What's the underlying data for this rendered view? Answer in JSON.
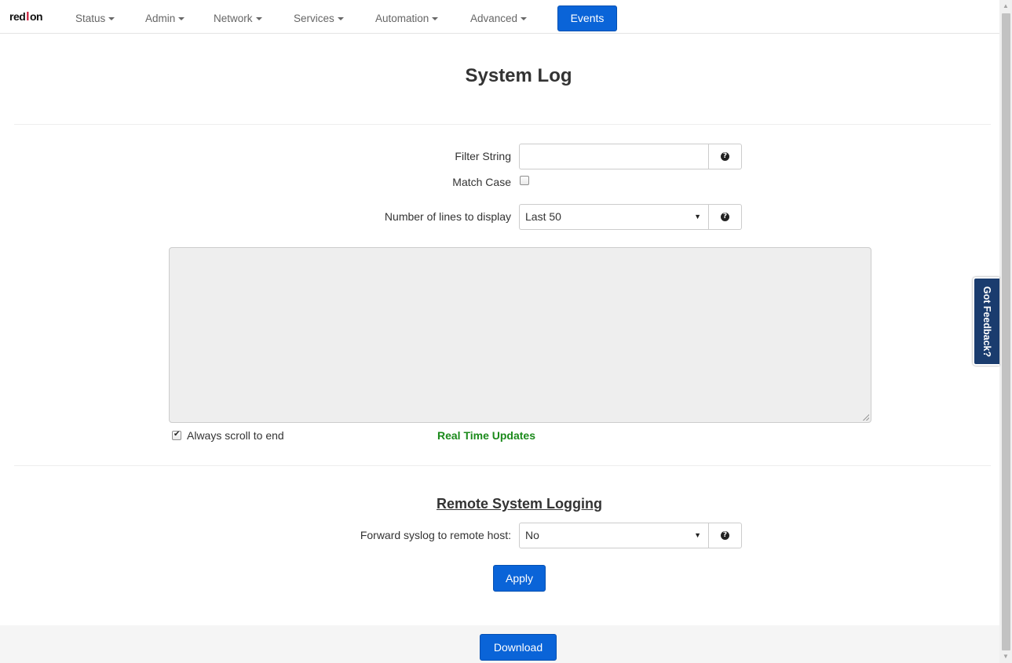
{
  "brand": {
    "text_left": "red",
    "text_mark": "l",
    "text_right": "on"
  },
  "nav": {
    "items": [
      {
        "label": "Status"
      },
      {
        "label": "Admin"
      },
      {
        "label": "Network"
      },
      {
        "label": "Services"
      },
      {
        "label": "Automation"
      },
      {
        "label": "Advanced"
      }
    ],
    "active": {
      "label": "Events"
    }
  },
  "page": {
    "title": "System Log"
  },
  "filter": {
    "label": "Filter String",
    "value": "",
    "help_icon": "question-circle-icon"
  },
  "match_case": {
    "label": "Match Case",
    "checked": false
  },
  "lines": {
    "label": "Number of lines to display",
    "value": "Last 50",
    "help_icon": "question-circle-icon"
  },
  "log": {
    "content": ""
  },
  "scroll_end": {
    "label": "Always scroll to end",
    "checked": true
  },
  "realtime": {
    "label": "Real Time Updates",
    "color": "#1b8a1b"
  },
  "remote": {
    "title": "Remote System Logging",
    "forward_label": "Forward syslog to remote host:",
    "forward_value": "No",
    "apply_label": "Apply"
  },
  "footer": {
    "download_label": "Download"
  },
  "feedback": {
    "label": "Got Feedback?"
  },
  "colors": {
    "accent": "#0a64d8",
    "feedback_bg": "#1a3c6e",
    "log_bg": "#eeeeee"
  }
}
